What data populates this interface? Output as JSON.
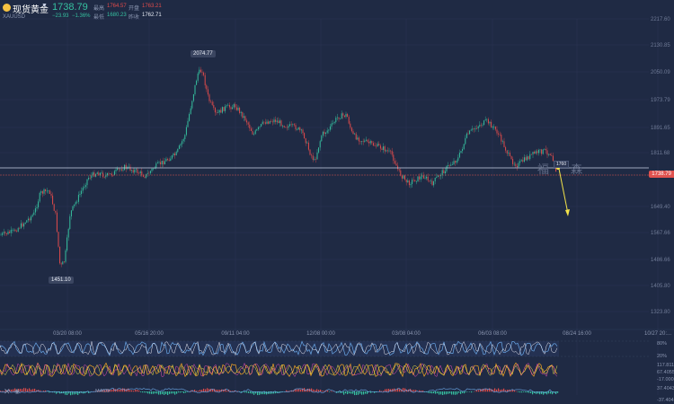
{
  "header": {
    "symbol": "现货黄金",
    "code": "XAUUSD",
    "price": "1738.79",
    "change": "−23.93",
    "change_pct": "−1.36%",
    "high_label": "最高",
    "high_value": "1764.57",
    "open_label": "开盘",
    "open_value": "1763.21",
    "low_label": "最低",
    "low_value": "1680.23",
    "prevclose_label": "昨收",
    "prevclose_value": "1762.71"
  },
  "price_axis": [
    "2217.60",
    "2130.85",
    "2050.09",
    "1973.79",
    "1891.65",
    "1811.68",
    "1649.40",
    "1567.66",
    "1486.66",
    "1405.80",
    "1323.80"
  ],
  "current_price_badge": "1738.79",
  "marker_label": "1760",
  "peak_label": "2074.77",
  "trough_label": "1451.10",
  "time_axis": [
    "03/20 08:00",
    "05/16 20:00",
    "09/11 04:00",
    "12/08 00:00",
    "03/08 04:00",
    "06/03 08:00",
    "08/24 16:00",
    "10/27 20:..."
  ],
  "watermark": "福 森",
  "indicators": {
    "rsi_axis": [
      "80%",
      "20%"
    ],
    "kdj_axis": [
      "117.811",
      "67.4055",
      "-17.0003"
    ],
    "macd_axis": [
      "37.40430",
      "-37.40430"
    ],
    "macd_label": "MACD"
  },
  "icons": {
    "close": "close-icon",
    "eye": "eye-icon",
    "gold": "gold-coin-icon",
    "caret": "chevron-down-icon"
  },
  "colors": {
    "bg": "#1f2a44",
    "up": "#36c0a0",
    "down": "#e04b4b",
    "arrow": "#f2e24a"
  }
}
